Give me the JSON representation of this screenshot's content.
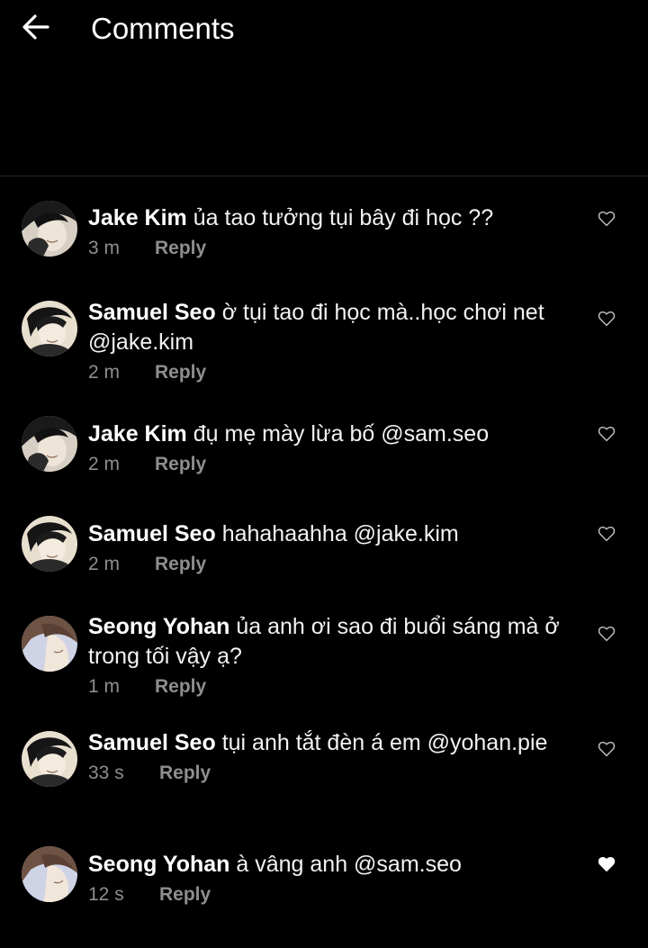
{
  "header": {
    "title": "Comments"
  },
  "comments": [
    {
      "user": "Jake Kim",
      "text": "ủa tao tưởng tụi bây đi học ??",
      "time": "3 m",
      "reply": "Reply",
      "liked": false
    },
    {
      "user": "Samuel Seo",
      "text": "ờ tụi tao đi học mà..học chơi net @jake.kim",
      "time": "2 m",
      "reply": "Reply",
      "liked": false
    },
    {
      "user": "Jake Kim",
      "text": "đụ mẹ mày lừa bố @sam.seo",
      "time": "2 m",
      "reply": "Reply",
      "liked": false
    },
    {
      "user": "Samuel Seo",
      "text": "hahahaahha @jake.kim",
      "time": "2 m",
      "reply": "Reply",
      "liked": false
    },
    {
      "user": "Seong Yohan",
      "text": "ủa anh ơi sao đi buổi sáng mà ở trong tối vậy ạ?",
      "time": "1 m",
      "reply": "Reply",
      "liked": false
    },
    {
      "user": "Samuel Seo",
      "text": "tụi anh tắt đèn á em @yohan.pie",
      "time": "33 s",
      "reply": "Reply",
      "liked": false
    },
    {
      "user": "Seong Yohan",
      "text": "à vâng anh @sam.seo",
      "time": "12 s",
      "reply": "Reply",
      "liked": true
    }
  ],
  "icons": {
    "back": "arrow-left-icon",
    "like_empty": "heart-outline-icon",
    "like_filled": "heart-filled-icon"
  },
  "colors": {
    "background": "#000000",
    "text": "#ffffff",
    "meta": "#8e8e8e",
    "divider": "#2a2a2a"
  }
}
